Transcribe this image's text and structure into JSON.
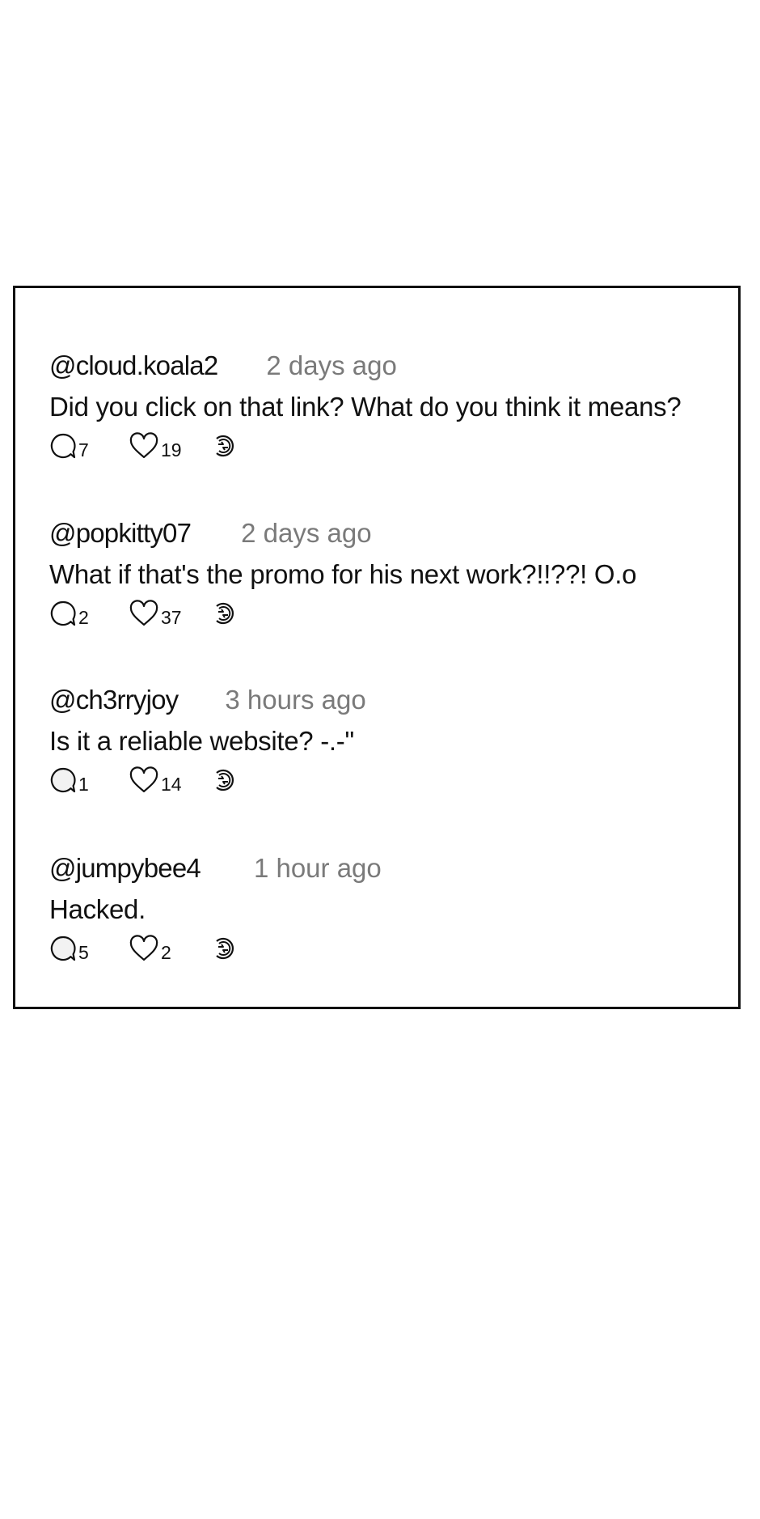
{
  "colors": {
    "text": "#111111",
    "timestamp": "#7a7a7a",
    "border": "#111111",
    "background": "#ffffff"
  },
  "icons": {
    "reply": "speech-bubble-icon",
    "like": "heart-icon",
    "share": "repost-icon"
  },
  "comments": [
    {
      "username": "@cloud.koala2",
      "time": "2 days ago",
      "text": "Did you click on that link? What do you think it means?",
      "replies": "7",
      "likes": "19"
    },
    {
      "username": "@popkitty07",
      "time": "2 days ago",
      "text": "What if that's the promo for his next work?!!??! O.o",
      "replies": "2",
      "likes": "37"
    },
    {
      "username": "@ch3rryjoy",
      "time": "3 hours ago",
      "text": "Is it a reliable website? -.-\"",
      "replies": "1",
      "likes": "14"
    },
    {
      "username": "@jumpybee4",
      "time": "1 hour ago",
      "text": "Hacked.",
      "replies": "5",
      "likes": "2"
    }
  ]
}
